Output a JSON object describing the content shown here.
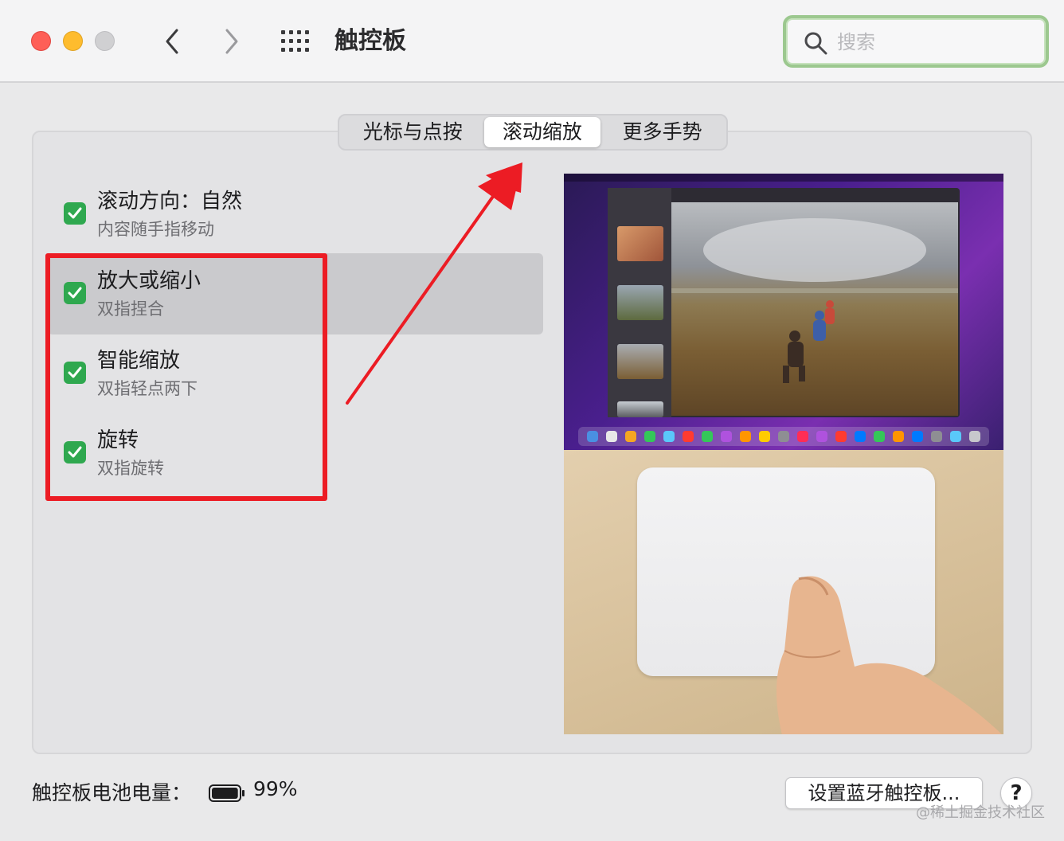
{
  "window": {
    "title": "触控板",
    "search_placeholder": "搜索"
  },
  "tabs": [
    {
      "label": "光标与点按",
      "selected": false
    },
    {
      "label": "滚动缩放",
      "selected": true
    },
    {
      "label": "更多手势",
      "selected": false
    }
  ],
  "options": [
    {
      "title": "滚动方向：自然",
      "subtitle": "内容随手指移动",
      "checked": true,
      "selected": false
    },
    {
      "title": "放大或缩小",
      "subtitle": "双指捏合",
      "checked": true,
      "selected": true
    },
    {
      "title": "智能缩放",
      "subtitle": "双指轻点两下",
      "checked": true,
      "selected": false
    },
    {
      "title": "旋转",
      "subtitle": "双指旋转",
      "checked": true,
      "selected": false
    }
  ],
  "footer": {
    "battery_label": "触控板电池电量：",
    "battery_percent": "99%",
    "battery_level": 0.99,
    "bluetooth_button": "设置蓝牙触控板...",
    "help_button": "?"
  },
  "watermark": "@稀土掘金技术社区",
  "colors": {
    "checkbox": "#2fa84f",
    "annotation_red": "#ec1c24",
    "search_focus": "#9cc88f"
  }
}
